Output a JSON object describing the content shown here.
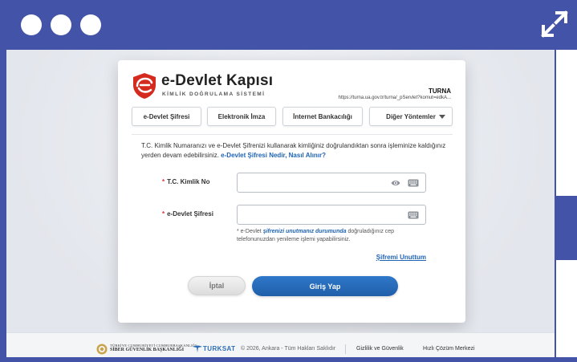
{
  "brand": {
    "title": "e-Devlet Kapısı",
    "subtitle": "KİMLİK DOĞRULAMA SİSTEMİ",
    "service_name": "TURNA",
    "service_url": "https://turna.ua.gov.tr/turna/_pServlet?komut=edkA..."
  },
  "tabs": [
    {
      "label": "e-Devlet Şifresi"
    },
    {
      "label": "Elektronik İmza"
    },
    {
      "label": "İnternet Bankacılığı"
    },
    {
      "label": "Diğer Yöntemler"
    }
  ],
  "intro": {
    "text": "T.C. Kimlik Numaranızı ve e-Devlet Şifrenizi kullanarak kimliğiniz doğrulandıktan sonra işleminize kaldığınız yerden devam edebilirsiniz. ",
    "link": "e-Devlet Şifresi Nedir, Nasıl Alınır?"
  },
  "form": {
    "required_mark": "*",
    "tc_label": "T.C. Kimlik No",
    "tc_value": "",
    "password_label": "e-Devlet Şifresi",
    "password_value": "",
    "hint_prefix": "* e-Devlet ",
    "hint_link": "şifrenizi unutmanız durumunda",
    "hint_suffix": " doğruladığınız cep telefonunuzdan yenileme işlemi yapabilirsiniz.",
    "forgot_label": "Şifremi Unuttum",
    "cancel_label": "İptal",
    "login_label": "Giriş Yap"
  },
  "footer": {
    "sgb_line1": "TÜRKİYE CUMHURİYETİ CUMHURBAŞKANLIĞI",
    "sgb_line2": "SİBER GÜVENLİK BAŞKANLIĞI",
    "turksat": "TURKSAT",
    "copyright": "© 2026, Ankara - Tüm Hakları Saklıdır",
    "privacy_link": "Gizlilik ve Güvenlik",
    "help_link": "Hızlı Çözüm Merkezi"
  },
  "colors": {
    "frame": "#4353a8",
    "brand_red": "#d52b1e",
    "link_blue": "#1f63b6",
    "login_button": "#2769b9"
  },
  "icons": {
    "logo": "e-devlet-logo-icon",
    "eye": "eye-icon",
    "keyboard": "keyboard-icon",
    "expand": "expand-icon"
  }
}
